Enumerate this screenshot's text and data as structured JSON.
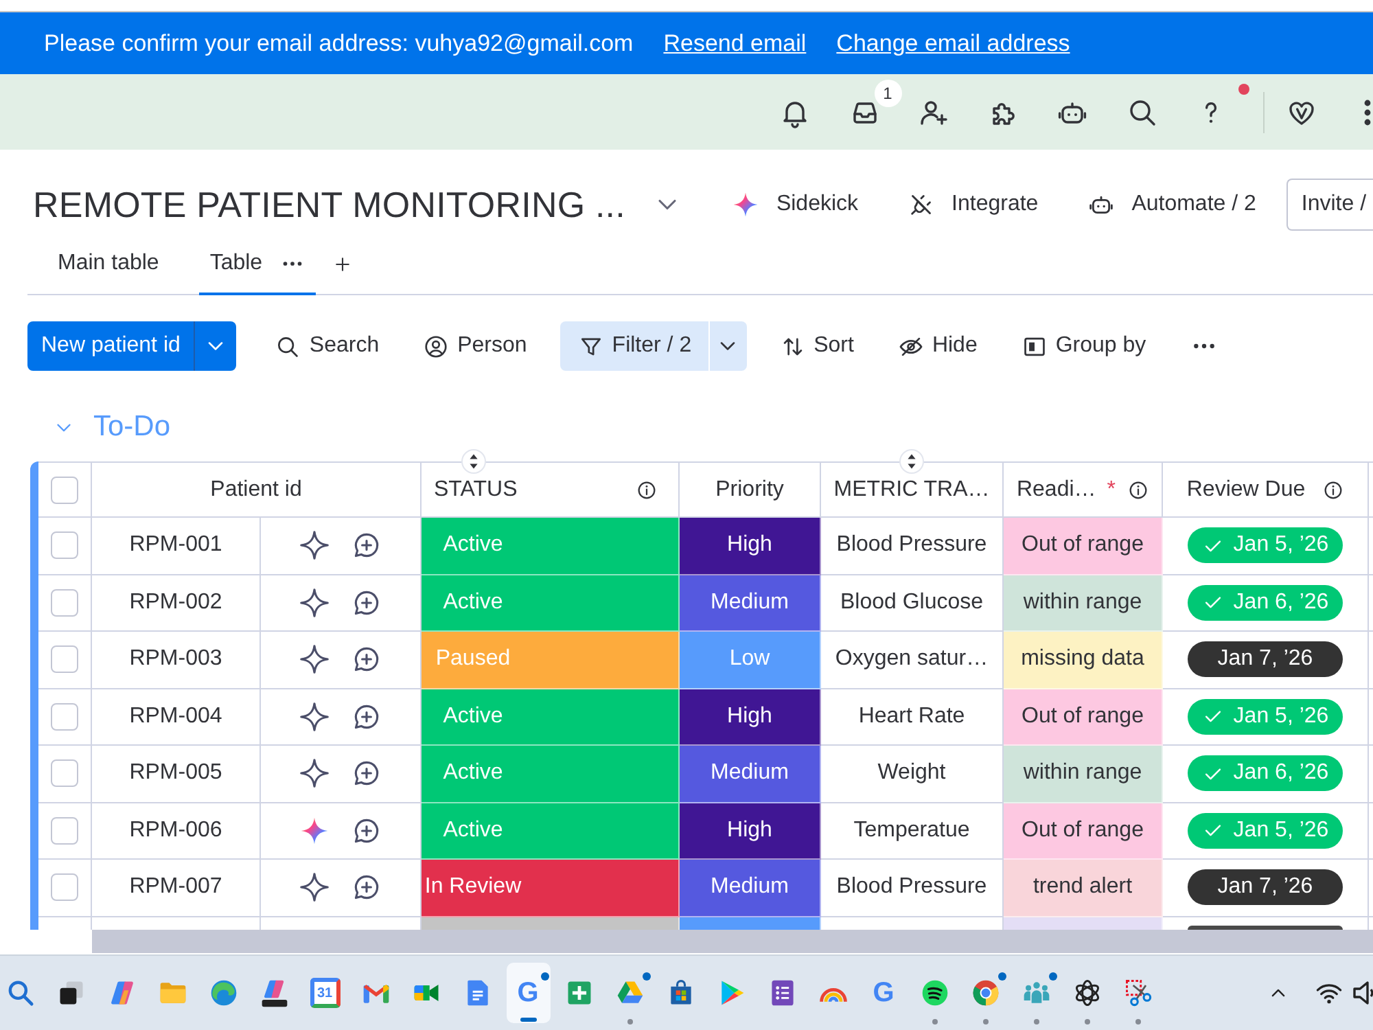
{
  "banner": {
    "message": "Please confirm your email address: vuhya92@gmail.com",
    "links": [
      "Resend email",
      "Change email address"
    ]
  },
  "topbar": {
    "icons": [
      {
        "kind": "bell",
        "dot": false
      },
      {
        "kind": "inbox",
        "badge": "1",
        "dot": false
      },
      {
        "kind": "add_person",
        "dot": false
      },
      {
        "kind": "puzzle",
        "dot": false
      },
      {
        "kind": "robot",
        "dot": false
      },
      {
        "kind": "search",
        "dot": false
      },
      {
        "kind": "help",
        "dot": true
      },
      {
        "kind": "heart",
        "dot": false
      },
      {
        "kind": "more",
        "dot": false
      }
    ]
  },
  "board": {
    "title": "REMOTE PATIENT MONITORING ...",
    "actions": [
      {
        "kind": "sparkle",
        "label": "Sidekick"
      },
      {
        "kind": "plug",
        "label": "Integrate"
      },
      {
        "kind": "robot",
        "label": "Automate / 2"
      }
    ],
    "invite": "Invite /"
  },
  "tabs": [
    {
      "label": "Main table",
      "selected": false,
      "menu": false
    },
    {
      "label": "Table",
      "selected": true,
      "menu": true
    }
  ],
  "toolbar": {
    "primary": "New patient id",
    "tools": [
      {
        "kind": "search",
        "label": "Search",
        "active": false,
        "split": false
      },
      {
        "kind": "person",
        "label": "Person",
        "active": false,
        "split": false
      },
      {
        "kind": "filter",
        "label": "Filter / 2",
        "active": true,
        "split": true
      },
      {
        "kind": "sort",
        "label": "Sort",
        "active": false,
        "split": false
      },
      {
        "kind": "hide",
        "label": "Hide",
        "active": false,
        "split": false
      },
      {
        "kind": "group",
        "label": "Group by",
        "active": false,
        "split": false
      },
      {
        "kind": "more",
        "active": false,
        "split": false
      }
    ]
  },
  "group": {
    "title": "To-Do",
    "expanded": true
  },
  "table": {
    "select_all": {
      "checked": false
    },
    "columns": [
      {
        "kind": "name",
        "label": "Patient id",
        "info": false,
        "handle": false
      },
      {
        "kind": "status",
        "label": "STATUS",
        "info": true,
        "handle": true
      },
      {
        "kind": "priority",
        "label": "Priority",
        "info": false,
        "handle": false
      },
      {
        "kind": "metric",
        "label": "METRIC TRA…",
        "info": false,
        "handle": true
      },
      {
        "kind": "reading",
        "label": "Readi…",
        "required": "*",
        "info": true,
        "handle": false
      },
      {
        "kind": "due",
        "label": "Review Due",
        "info": true,
        "handle": false
      }
    ],
    "rows": [
      {
        "checked": false,
        "id": "RPM-001",
        "ai_active": false,
        "status": {
          "label": "Active",
          "color": "#00c875"
        },
        "priority": {
          "label": "High",
          "color": "#401694"
        },
        "metric": "Blood Pressure",
        "reading": {
          "label": "Out of range",
          "color": "#fdc8e1"
        },
        "due": {
          "label": "Jan 5, ’26",
          "done": true
        }
      },
      {
        "checked": false,
        "id": "RPM-002",
        "ai_active": false,
        "status": {
          "label": "Active",
          "color": "#00c875"
        },
        "priority": {
          "label": "Medium",
          "color": "#5559df"
        },
        "metric": "Blood Glucose",
        "reading": {
          "label": "within range",
          "color": "#cfe4da"
        },
        "due": {
          "label": "Jan 6, ’26",
          "done": true
        }
      },
      {
        "checked": false,
        "id": "RPM-003",
        "ai_active": false,
        "status": {
          "label": "Paused",
          "color": "#fdab3d"
        },
        "priority": {
          "label": "Low",
          "color": "#579bfc"
        },
        "metric": "Oxygen satur…",
        "reading": {
          "label": "missing data",
          "color": "#fdf2c3"
        },
        "due": {
          "label": "Jan 7, ’26",
          "done": false
        }
      },
      {
        "checked": false,
        "id": "RPM-004",
        "ai_active": false,
        "status": {
          "label": "Active",
          "color": "#00c875"
        },
        "priority": {
          "label": "High",
          "color": "#401694"
        },
        "metric": "Heart Rate",
        "reading": {
          "label": "Out of range",
          "color": "#fdc8e1"
        },
        "due": {
          "label": "Jan 5, ’26",
          "done": true
        }
      },
      {
        "checked": false,
        "id": "RPM-005",
        "ai_active": false,
        "status": {
          "label": "Active",
          "color": "#00c875"
        },
        "priority": {
          "label": "Medium",
          "color": "#5559df"
        },
        "metric": "Weight",
        "reading": {
          "label": "within range",
          "color": "#cfe4da"
        },
        "due": {
          "label": "Jan 6, ’26",
          "done": true
        }
      },
      {
        "checked": false,
        "id": "RPM-006",
        "ai_active": true,
        "status": {
          "label": "Active",
          "color": "#00c875"
        },
        "priority": {
          "label": "High",
          "color": "#401694"
        },
        "metric": "Temperatue",
        "reading": {
          "label": "Out of range",
          "color": "#fdc8e1"
        },
        "due": {
          "label": "Jan 5, ’26",
          "done": true
        }
      },
      {
        "checked": false,
        "id": "RPM-007",
        "ai_active": false,
        "status": {
          "label": "In Review",
          "color": "#e2304d"
        },
        "priority": {
          "label": "Medium",
          "color": "#5559df"
        },
        "metric": "Blood Pressure",
        "reading": {
          "label": "trend alert",
          "color": "#f9d5da"
        },
        "due": {
          "label": "Jan 7, ’26",
          "done": false
        }
      },
      {
        "status": {
          "color": "#c4c4c4"
        },
        "priority": {
          "color": "#579bfc"
        },
        "reading": {
          "color": "#e4def6"
        },
        "due": {
          "done": false
        }
      }
    ]
  },
  "taskbar": {
    "apps": [
      {
        "kind": "search",
        "running": false,
        "notify": false,
        "selected": false
      },
      {
        "kind": "windows",
        "running": false,
        "notify": false,
        "selected": false
      },
      {
        "kind": "ribbon",
        "running": false,
        "notify": false,
        "selected": false
      },
      {
        "kind": "folder",
        "running": false,
        "notify": false,
        "selected": false
      },
      {
        "kind": "swirl",
        "running": false,
        "notify": false,
        "selected": false
      },
      {
        "kind": "ribbon_tile",
        "running": false,
        "notify": false,
        "selected": false
      },
      {
        "kind": "calendar",
        "text": "31",
        "running": false,
        "notify": false,
        "selected": false
      },
      {
        "kind": "mail",
        "running": false,
        "notify": false,
        "selected": false
      },
      {
        "kind": "camera",
        "running": false,
        "notify": false,
        "selected": false
      },
      {
        "kind": "document",
        "running": false,
        "notify": false,
        "selected": false
      },
      {
        "kind": "letter",
        "text": "G",
        "running": false,
        "notify": true,
        "selected": true
      },
      {
        "kind": "plus_tile",
        "running": false,
        "notify": false,
        "selected": false
      },
      {
        "kind": "triangle",
        "running": true,
        "notify": true,
        "selected": false
      },
      {
        "kind": "bag",
        "running": false,
        "notify": false,
        "selected": false
      },
      {
        "kind": "play",
        "running": false,
        "notify": false,
        "selected": false
      },
      {
        "kind": "form",
        "running": false,
        "notify": false,
        "selected": false
      },
      {
        "kind": "rainbow",
        "running": false,
        "notify": false,
        "selected": false
      },
      {
        "kind": "letter",
        "text": "G",
        "running": false,
        "notify": false,
        "selected": false
      },
      {
        "kind": "waves",
        "running": true,
        "notify": false,
        "selected": false
      },
      {
        "kind": "tricolor",
        "running": true,
        "notify": true,
        "selected": false
      },
      {
        "kind": "people",
        "running": true,
        "notify": true,
        "selected": false
      },
      {
        "kind": "knot",
        "running": true,
        "notify": false,
        "selected": false
      },
      {
        "kind": "scissors",
        "running": true,
        "notify": false,
        "selected": false
      }
    ],
    "tray": [
      {
        "kind": "chevron"
      },
      {
        "kind": "wifi"
      },
      {
        "kind": "speaker"
      }
    ]
  }
}
